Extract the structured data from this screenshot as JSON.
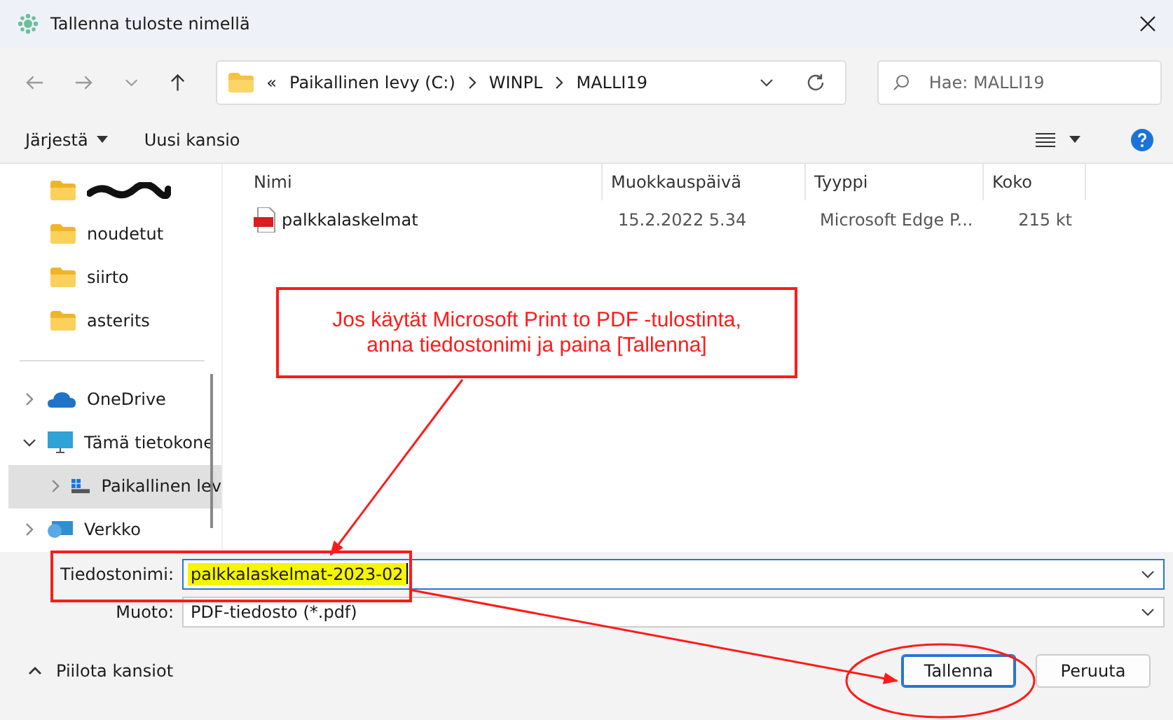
{
  "window": {
    "title": "Tallenna tuloste nimellä"
  },
  "address": {
    "overflow": "«",
    "crumbs": [
      "Paikallinen levy (C:)",
      "WINPL",
      "MALLI19"
    ]
  },
  "search": {
    "placeholder": "Hae: MALLI19"
  },
  "toolbar": {
    "organize": "Järjestä",
    "new_folder": "Uusi kansio"
  },
  "quick_access": [
    {
      "redacted": true,
      "selected": false
    },
    {
      "label": "noudetut",
      "redacted": false,
      "selected": false
    },
    {
      "label": "siirto",
      "redacted": false,
      "selected": false
    },
    {
      "label": "asterits",
      "redacted": false,
      "selected": false
    }
  ],
  "tree": [
    {
      "kind": "cloud",
      "label": "OneDrive",
      "expanded": false,
      "selected": false
    },
    {
      "kind": "computer",
      "label": "Tämä tietokone",
      "expanded": true,
      "selected": false,
      "children": [
        {
          "kind": "drive",
          "label": "Paikallinen lev",
          "expanded": false,
          "selected": true
        }
      ]
    },
    {
      "kind": "network",
      "label": "Verkko",
      "expanded": false,
      "selected": false
    }
  ],
  "table": {
    "columns": [
      "Nimi",
      "Muokkauspäivä",
      "Tyyppi",
      "Koko"
    ],
    "rows": [
      {
        "name": "palkkalaskelmat",
        "modified": "15.2.2022 5.34",
        "type": "Microsoft Edge P...",
        "size": "215 kt"
      }
    ]
  },
  "form": {
    "filename_label": "Tiedostonimi:",
    "filename": "palkkalaskelmat-2023-02",
    "filename_highlighted": true,
    "format_label": "Muoto:",
    "format": "PDF-tiedosto (*.pdf)"
  },
  "footer": {
    "hide_folders": "Piilota kansiot",
    "buttons": [
      {
        "label": "Tallenna",
        "primary": true
      },
      {
        "label": "Peruuta",
        "primary": false
      }
    ]
  },
  "callout": {
    "lines": [
      "Jos käytät Microsoft Print to PDF -tulostinta,",
      "anna tiedostonimi ja paina [Tallenna]"
    ]
  }
}
